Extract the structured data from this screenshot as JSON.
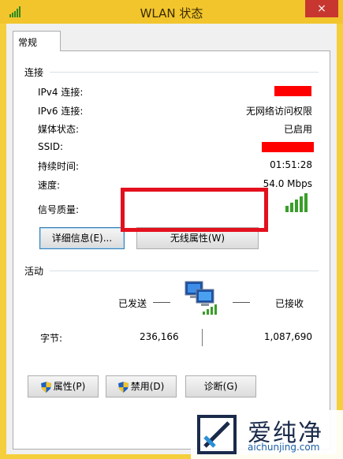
{
  "window": {
    "title": "WLAN 状态",
    "close_glyph": "×"
  },
  "tabs": [
    {
      "label": "常规"
    }
  ],
  "connection": {
    "heading": "连接",
    "rows": [
      {
        "label": "IPv4 连接:",
        "value": ""
      },
      {
        "label": "IPv6 连接:",
        "value": "无网络访问权限"
      },
      {
        "label": "媒体状态:",
        "value": "已启用"
      },
      {
        "label": "SSID:",
        "value": ""
      },
      {
        "label": "持续时间:",
        "value": "01:51:28"
      },
      {
        "label": "速度:",
        "value": "54.0 Mbps"
      },
      {
        "label": "信号质量:",
        "value": ""
      }
    ],
    "signal_bars": 5,
    "details_button": "详细信息(E)...",
    "wireless_props_button": "无线属性(W)"
  },
  "activity": {
    "heading": "活动",
    "sent_label": "已发送",
    "received_label": "已接收",
    "bytes_label": "字节:",
    "bytes_sent": "236,166",
    "bytes_received": "1,087,690"
  },
  "buttons": {
    "properties": "属性(P)",
    "disable": "禁用(D)",
    "diagnose": "诊断(G)"
  },
  "watermark": {
    "brand": "爱纯净",
    "url": "aichunjing.com"
  },
  "colors": {
    "titlebar": "#f2c52d",
    "redaction": "#ff0000",
    "highlight": "#e3101e",
    "signal": "#3a9e2a"
  }
}
